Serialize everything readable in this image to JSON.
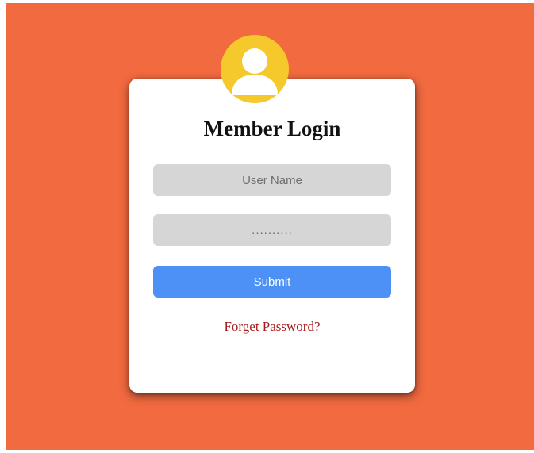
{
  "login": {
    "title": "Member Login",
    "username_placeholder": "User Name",
    "password_placeholder": "..........",
    "submit_label": "Submit",
    "forgot_label": "Forget Password?"
  },
  "avatar": {
    "icon": "user-icon"
  },
  "colors": {
    "background": "#f26a3f",
    "card": "#ffffff",
    "avatar": "#f5c92b",
    "field": "#d6d6d6",
    "submit": "#4d91f7",
    "link": "#a81a1a"
  }
}
